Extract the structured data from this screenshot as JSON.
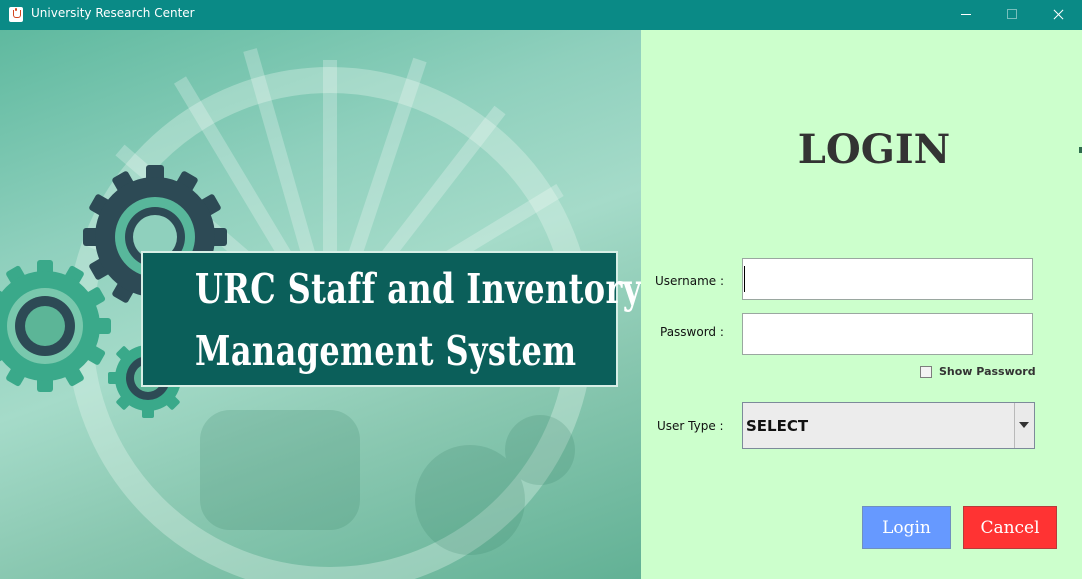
{
  "window": {
    "title": "University Research Center"
  },
  "banner": {
    "line1": "URC Staff and Inventory",
    "line2": "Management System"
  },
  "login": {
    "heading": "LOGIN",
    "username_label": "Username :",
    "username_value": "",
    "password_label": "Password :",
    "password_value": "",
    "show_password_label": "Show Password",
    "show_password_checked": false,
    "user_type_label": "User Type :",
    "user_type_selected": "SELECT",
    "login_button": "Login",
    "cancel_button": "Cancel"
  },
  "colors": {
    "title_bar": "#0a8a86",
    "login_panel_bg": "#ccffcc",
    "banner_bg": "#0b5f5a",
    "login_button": "#6699ff",
    "cancel_button": "#ff3333"
  },
  "icons": {
    "app": "java-cup-icon",
    "minimize": "minimize-icon",
    "maximize": "maximize-icon",
    "close": "close-icon",
    "dropdown": "chevron-down-icon"
  }
}
